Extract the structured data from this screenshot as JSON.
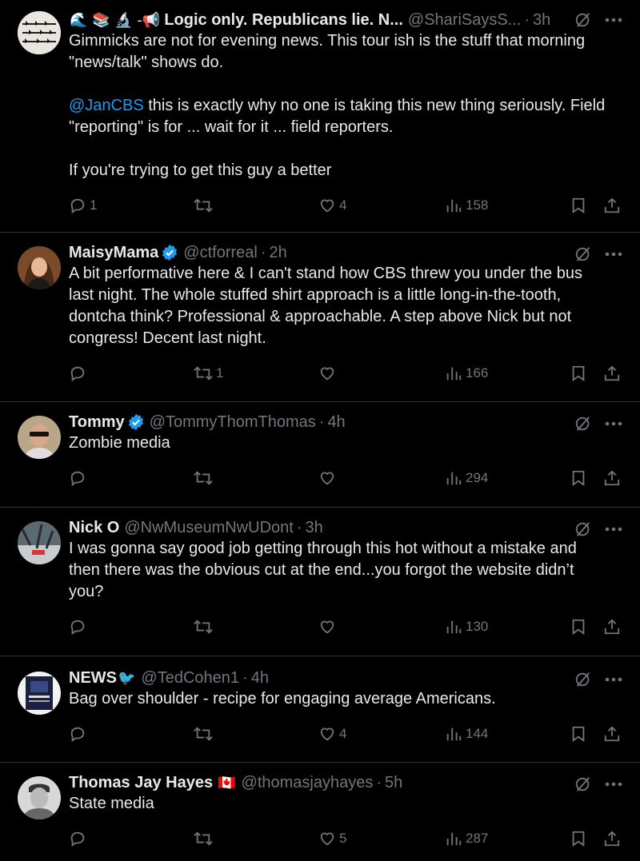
{
  "tweets": [
    {
      "name": "Logic only. Republicans lie. N...",
      "prefix_emojis": "🌊 📚 🔬 -📢",
      "verified": false,
      "handle": "@ShariSaysS...",
      "time": "3h",
      "text_parts": [
        "Gimmicks are not for evening news. This tour ish is the stuff that morning \"news/talk\" shows do.\n\n",
        "@JanCBS",
        " this is exactly why no one is taking this new thing seriously. Field \"reporting\" is for ... wait for it ... field reporters.\n\nIf you're trying to get this guy a better"
      ],
      "replies": "1",
      "retweets": "",
      "likes": "4",
      "views": "158"
    },
    {
      "name": "MaisyMama",
      "verified": true,
      "handle": "@ctforreal",
      "time": "2h",
      "text": "A bit performative here & I can't stand how CBS threw you under the bus last night. The whole stuffed shirt approach is a little long-in-the-tooth, dontcha think? Professional & approachable. A step above Nick but not congress! Decent last night.",
      "replies": "",
      "retweets": "1",
      "likes": "",
      "views": "166"
    },
    {
      "name": "Tommy",
      "verified": true,
      "handle": "@TommyThomThomas",
      "time": "4h",
      "text": "Zombie media",
      "replies": "",
      "retweets": "",
      "likes": "",
      "views": "294"
    },
    {
      "name": "Nick O",
      "verified": false,
      "handle": "@NwMuseumNwUDont",
      "time": "3h",
      "text": "I was gonna say good job getting through this hot without a mistake and then there was the obvious cut at the end...you forgot the website didn’t you?",
      "replies": "",
      "retweets": "",
      "likes": "",
      "views": "130"
    },
    {
      "name": "NEWS",
      "name_suffix_emoji": "🐦",
      "verified": false,
      "handle": "@TedCohen1",
      "time": "4h",
      "text": "Bag over shoulder - recipe for engaging average Americans.",
      "replies": "",
      "retweets": "",
      "likes": "4",
      "views": "144"
    },
    {
      "name": "Thomas Jay Hayes",
      "name_suffix_emoji": "🇨🇦",
      "verified": false,
      "handle": "@thomasjayhayes",
      "time": "5h",
      "text": "State media",
      "replies": "",
      "retweets": "",
      "likes": "5",
      "views": "287"
    }
  ],
  "colors": {
    "background": "#000000",
    "text": "#e7e9ea",
    "muted": "#71767b",
    "mention": "#1d9bf0",
    "verified": "#1d9bf0",
    "divider": "#2f3336"
  },
  "icons": [
    "reply-icon",
    "retweet-icon",
    "like-icon",
    "views-icon",
    "bookmark-icon",
    "share-icon",
    "grok-icon",
    "more-icon",
    "verified-badge-icon"
  ]
}
